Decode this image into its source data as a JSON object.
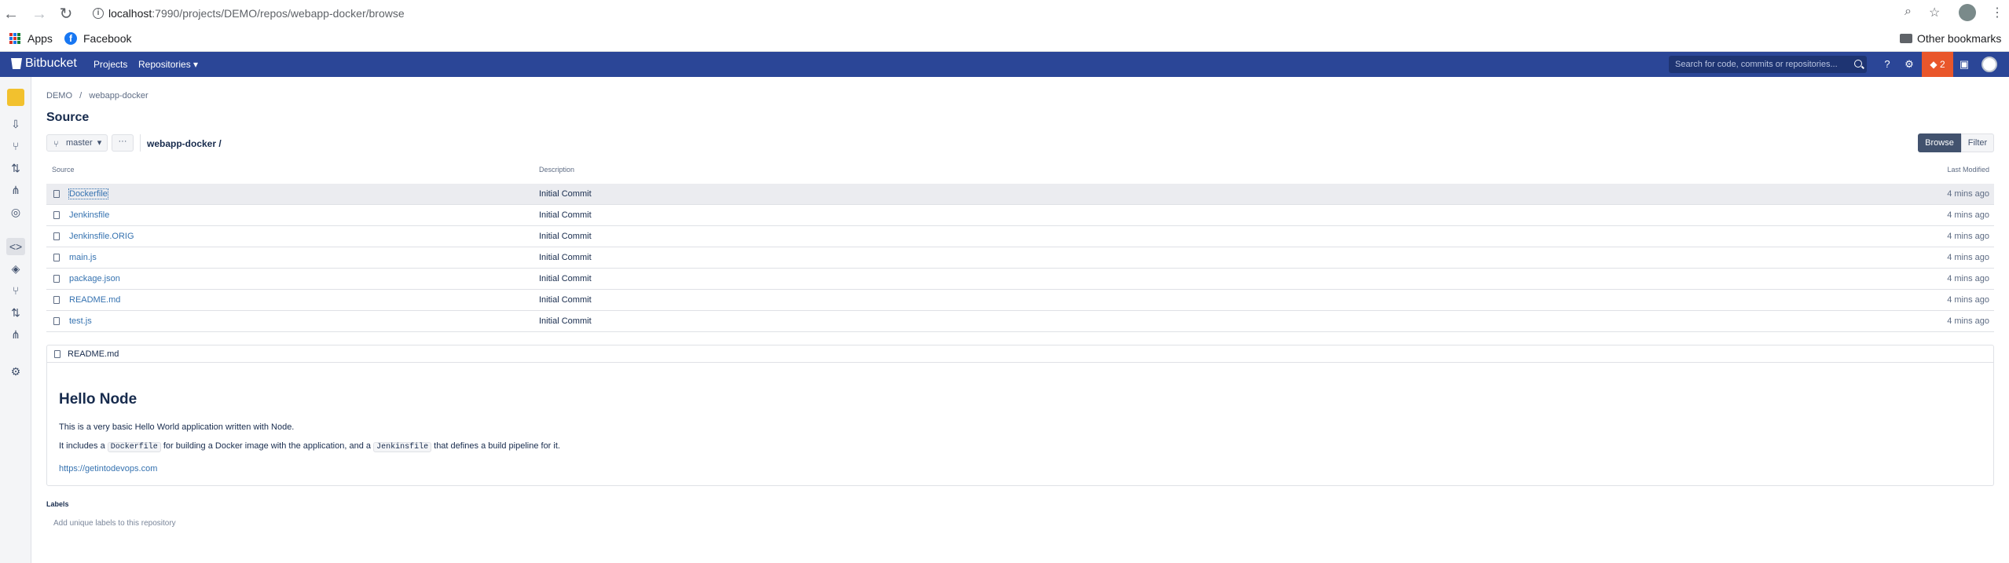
{
  "browser": {
    "url_host": "localhost",
    "url_path": ":7990/projects/DEMO/repos/webapp-docker/browse",
    "bookmarks": [
      "Apps",
      "Facebook"
    ],
    "other_bookmarks": "Other bookmarks"
  },
  "header": {
    "brand": "Bitbucket",
    "nav": [
      "Projects",
      "Repositories ▾"
    ],
    "search_placeholder": "Search for code, commits or repositories...",
    "notification_count": "2"
  },
  "sidebar": {
    "icons": [
      "clone-icon",
      "create-branch-icon",
      "create-pull-request-icon",
      "fork-icon",
      "compare-icon",
      "source-icon",
      "commits-icon",
      "branches-icon",
      "pull-requests-icon",
      "forks-icon",
      "settings-icon"
    ]
  },
  "breadcrumb": [
    "DEMO",
    "webapp-docker"
  ],
  "page_title": "Source",
  "branch": "master",
  "more_label": "···",
  "repo_path": "webapp-docker /",
  "view_toggle": {
    "browse": "Browse",
    "filter": "Filter"
  },
  "table": {
    "columns": [
      "Source",
      "Description",
      "Last Modified"
    ],
    "rows": [
      {
        "name": "Dockerfile",
        "desc": "Initial Commit",
        "modified": "4 mins ago"
      },
      {
        "name": "Jenkinsfile",
        "desc": "Initial Commit",
        "modified": "4 mins ago"
      },
      {
        "name": "Jenkinsfile.ORIG",
        "desc": "Initial Commit",
        "modified": "4 mins ago"
      },
      {
        "name": "main.js",
        "desc": "Initial Commit",
        "modified": "4 mins ago"
      },
      {
        "name": "package.json",
        "desc": "Initial Commit",
        "modified": "4 mins ago"
      },
      {
        "name": "README.md",
        "desc": "Initial Commit",
        "modified": "4 mins ago"
      },
      {
        "name": "test.js",
        "desc": "Initial Commit",
        "modified": "4 mins ago"
      }
    ]
  },
  "readme": {
    "filename": "README.md",
    "heading": "Hello Node",
    "p1": "This is a very basic Hello World application written with Node.",
    "p2_a": "It includes a ",
    "p2_code1": "Dockerfile",
    "p2_b": " for building a Docker image with the application, and a ",
    "p2_code2": "Jenkinsfile",
    "p2_c": " that defines a build pipeline for it.",
    "link": "https://getintodevops.com"
  },
  "labels": {
    "title": "Labels",
    "add": "Add unique labels to this repository"
  }
}
